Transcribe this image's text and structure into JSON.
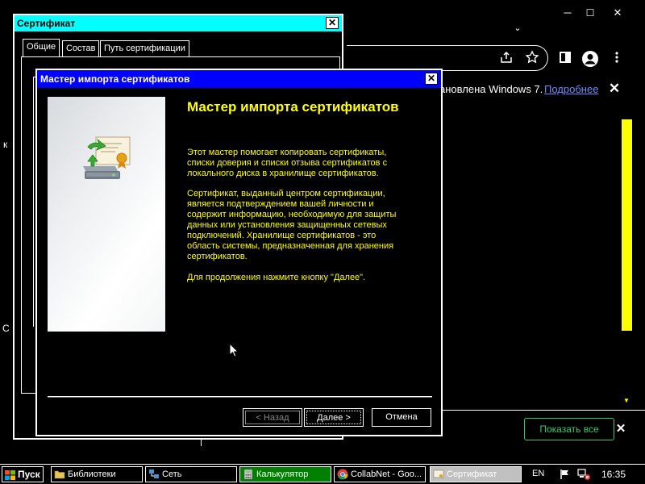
{
  "browser": {
    "minimize": "─",
    "maximize": "☐",
    "close": "✕",
    "tabs_chevron": "⌄",
    "share_icon": "share-icon",
    "star_icon": "star-icon",
    "infobar": {
      "text": "ановлена Windows 7.",
      "link": "Подробнее",
      "close": "✕"
    },
    "download_bar": {
      "show_all": "Показать все",
      "close": "✕"
    },
    "stray_left": [
      "к",
      "С"
    ]
  },
  "cert_dialog": {
    "title": "Сертификат",
    "close": "✕",
    "tabs": [
      "Общие",
      "Состав",
      "Путь сертификации"
    ],
    "partial_text": "П"
  },
  "wizard": {
    "title": "Мастер импорта сертификатов",
    "close": "✕",
    "heading": "Мастер импорта сертификатов",
    "paragraphs": [
      "Этот мастер помогает копировать сертификаты, списки доверия и списки отзыва сертификатов с локального диска в хранилище сертификатов.",
      "Сертификат, выданный центром сертификации, является подтверждением вашей личности и содержит информацию, необходимую для защиты данных или установления защищенных сетевых подключений. Хранилище сертификатов - это область системы, предназначенная для хранения сертификатов.",
      "Для продолжения нажмите кнопку \"Далее\"."
    ],
    "buttons": {
      "back": "< Назад",
      "next": "Далее >",
      "cancel": "Отмена"
    },
    "text_color": "#ffff00"
  },
  "taskbar": {
    "start": "Пуск",
    "tasks": [
      {
        "label": "Библиотеки",
        "icon": "folder-icon"
      },
      {
        "label": "Сеть",
        "icon": "network-icon"
      },
      {
        "label": "Калькулятор",
        "icon": "calculator-icon"
      },
      {
        "label": "CollabNet - Goo...",
        "icon": "chrome-icon"
      },
      {
        "label": "Сертификат",
        "icon": "certificate-icon"
      }
    ],
    "lang": "EN",
    "time": "16:35"
  },
  "colors": {
    "title_active": "#0000ff",
    "title_inactive": "#00ffff",
    "accent_yellow": "#ffff00",
    "link": "#6b8cff",
    "show_all_green": "#2ecc71"
  }
}
